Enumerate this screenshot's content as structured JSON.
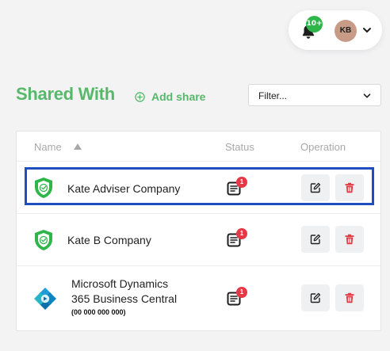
{
  "header": {
    "notification_count": "10+",
    "user_initials": "KB"
  },
  "page": {
    "title": "Shared With",
    "add_share_label": "Add share",
    "filter_placeholder": "Filter..."
  },
  "table": {
    "columns": {
      "name": "Name",
      "status": "Status",
      "operation": "Operation"
    },
    "sort": {
      "column": "name",
      "direction": "ascending"
    },
    "rows": [
      {
        "name": "Kate Adviser Company",
        "icon": "shield-check-icon",
        "status_count": "1",
        "selected": true
      },
      {
        "name": "Kate B Company",
        "icon": "shield-check-icon",
        "status_count": "1",
        "selected": false
      },
      {
        "name": "Microsoft Dynamics",
        "name_line2": "365 Business Central",
        "subtitle": "(00 000 000 000)",
        "icon": "dynamics-365-logo-icon",
        "status_count": "1",
        "selected": false
      }
    ]
  },
  "colors": {
    "accent_green": "#56b96a",
    "badge_green": "#2fb54a",
    "badge_red": "#e53945",
    "selection_blue": "#1f4fbf"
  }
}
